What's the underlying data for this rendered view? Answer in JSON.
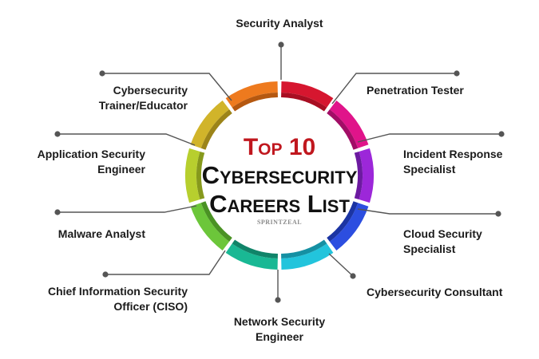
{
  "center": {
    "line1": "Top 10",
    "line2": "Cybersecurity",
    "line3": "Careers List",
    "title_color": "#c0171e",
    "brand": "SPRINTZEAL"
  },
  "careers": [
    {
      "id": "security-analyst",
      "label": "Security Analyst",
      "color": "#d6162f",
      "dark": "#a80e22"
    },
    {
      "id": "penetration-tester",
      "label": "Penetration Tester",
      "color": "#e0148a",
      "dark": "#a20d66"
    },
    {
      "id": "incident-response-specialist",
      "label": "Incident Response\nSpecialist",
      "color": "#9c27d9",
      "dark": "#6c1aa0"
    },
    {
      "id": "cloud-security-specialist",
      "label": "Cloud Security\nSpecialist",
      "color": "#2c4ee0",
      "dark": "#1b34a3"
    },
    {
      "id": "cybersecurity-consultant",
      "label": "Cybersecurity Consultant",
      "color": "#22c4dc",
      "dark": "#1590a3"
    },
    {
      "id": "network-security-engineer",
      "label": "Network Security\nEngineer",
      "color": "#19b894",
      "dark": "#108469"
    },
    {
      "id": "chief-information-security-officer",
      "label": "Chief Information Security\nOfficer (CISO)",
      "color": "#6cc63a",
      "dark": "#4a9224"
    },
    {
      "id": "malware-analyst",
      "label": "Malware Analyst",
      "color": "#b7cf2e",
      "dark": "#86991c"
    },
    {
      "id": "application-security-engineer",
      "label": "Application Security\nEngineer",
      "color": "#d1b42a",
      "dark": "#9c8419"
    },
    {
      "id": "cybersecurity-trainer-educator",
      "label": "Cybersecurity\nTrainer/Educator",
      "color": "#ee7a1e",
      "dark": "#b55810"
    }
  ],
  "connector_color": "#555555"
}
